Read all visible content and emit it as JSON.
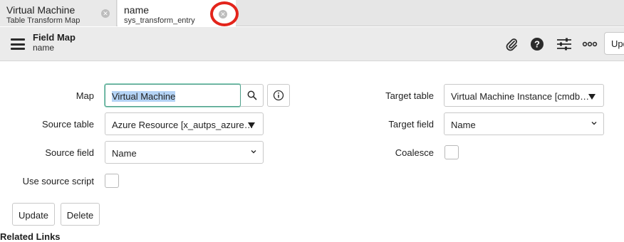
{
  "tabs": [
    {
      "title": "Virtual Machine",
      "subtitle": "Table Transform Map"
    },
    {
      "title": "name",
      "subtitle": "sys_transform_entry"
    }
  ],
  "header": {
    "title": "Field Map",
    "subtitle": "name",
    "update_label": "Update",
    "icons": [
      "paperclip-icon",
      "help-icon",
      "settings-icon",
      "more-icon"
    ]
  },
  "form": {
    "map": {
      "label": "Map",
      "value": "Virtual Machine"
    },
    "source_table": {
      "label": "Source table",
      "value": "Azure Resource [x_autps_azure…"
    },
    "source_field": {
      "label": "Source field",
      "value": "Name"
    },
    "use_source_script": {
      "label": "Use source script",
      "checked": false
    },
    "target_table": {
      "label": "Target table",
      "value": "Virtual Machine Instance [cmdb…"
    },
    "target_field": {
      "label": "Target field",
      "value": "Name"
    },
    "coalesce": {
      "label": "Coalesce",
      "checked": false
    }
  },
  "actions": {
    "update": "Update",
    "delete": "Delete"
  },
  "related_links": "Related Links"
}
